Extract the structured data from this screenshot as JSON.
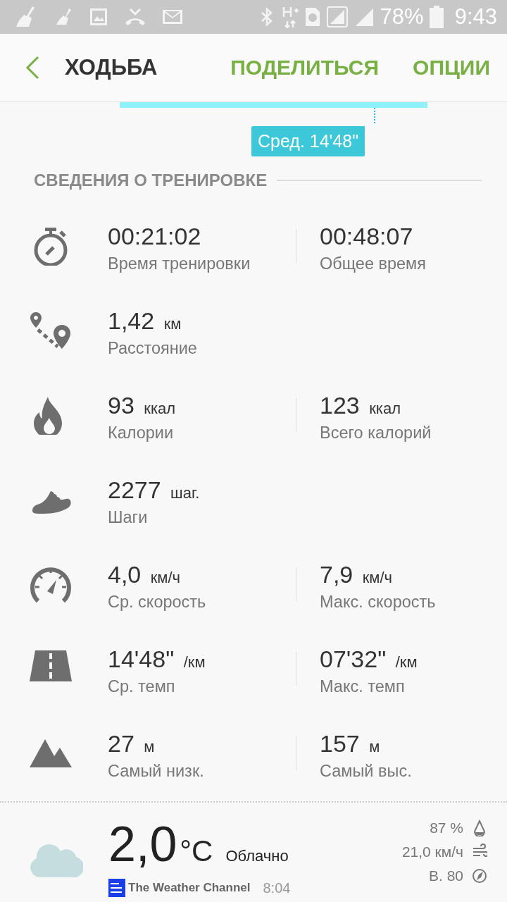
{
  "status_bar": {
    "battery": "78%",
    "time": "9:43"
  },
  "header": {
    "title": "ХОДЬБА",
    "actions": [
      "ПОДЕЛИТЬСЯ",
      "ОПЦИИ"
    ]
  },
  "pace_chart": {
    "average_label": "Сред. 14'48\""
  },
  "section_title": "СВЕДЕНИЯ О ТРЕНИРОВКЕ",
  "stats": [
    {
      "kind": "duration",
      "items": [
        {
          "value": "00:21:02",
          "label": "Время тренировки"
        },
        {
          "value": "00:48:07",
          "label": "Общее время"
        }
      ]
    },
    {
      "kind": "distance",
      "items": [
        {
          "value": "1,42",
          "unit": "км",
          "label": "Расстояние"
        }
      ]
    },
    {
      "kind": "calories",
      "items": [
        {
          "value": "93",
          "unit": "ккал",
          "label": "Калории"
        },
        {
          "value": "123",
          "unit": "ккал",
          "label": "Всего калорий"
        }
      ]
    },
    {
      "kind": "steps",
      "items": [
        {
          "value": "2277",
          "unit": "шаг.",
          "label": "Шаги"
        }
      ]
    },
    {
      "kind": "speed",
      "items": [
        {
          "value": "4,0",
          "unit": "км/ч",
          "label": "Ср. скорость"
        },
        {
          "value": "7,9",
          "unit": "км/ч",
          "label": "Макс. скорость"
        }
      ]
    },
    {
      "kind": "pace",
      "items": [
        {
          "value": "14'48\"",
          "unit": "/км",
          "label": "Ср. темп"
        },
        {
          "value": "07'32\"",
          "unit": "/км",
          "label": "Макс. темп"
        }
      ]
    },
    {
      "kind": "elevation",
      "items": [
        {
          "value": "27",
          "unit": "м",
          "label": "Самый низк."
        },
        {
          "value": "157",
          "unit": "м",
          "label": "Самый выс."
        }
      ]
    }
  ],
  "weather": {
    "temperature": "2,0",
    "unit": "°C",
    "condition": "Облачно",
    "provider": "The Weather Channel",
    "updated": "8:04",
    "humidity": "87 %",
    "wind": "21,0 км/ч",
    "wind_direction": "В. 80"
  }
}
